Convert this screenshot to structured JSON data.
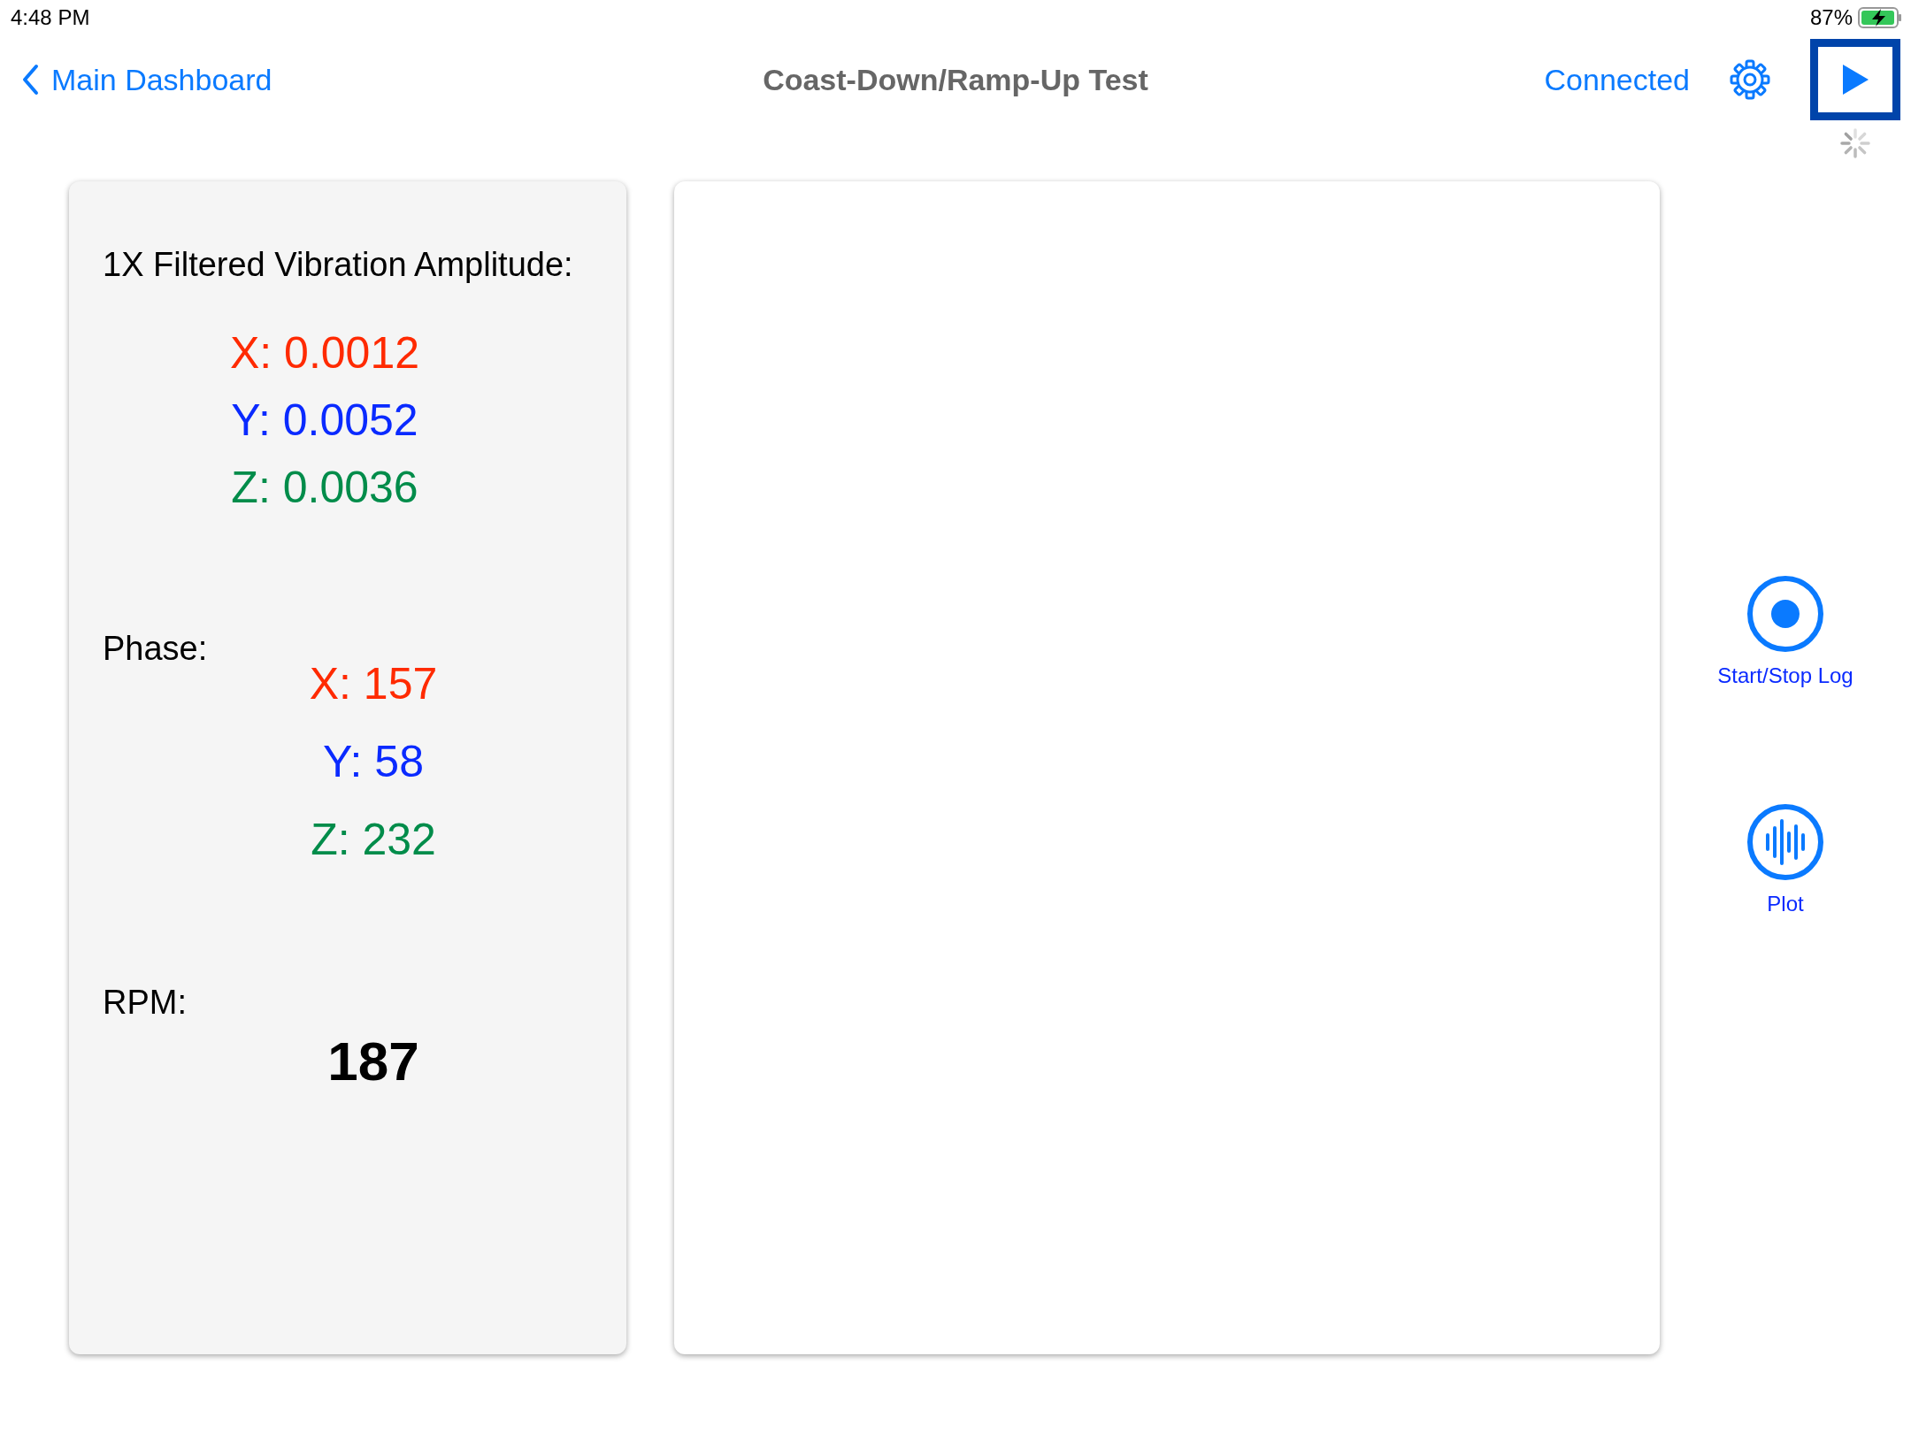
{
  "status_bar": {
    "time": "4:48 PM",
    "battery": "87%"
  },
  "nav_bar": {
    "back": "Main Dashboard",
    "title": "Coast-Down/Ramp-Up Test",
    "connection": "Connected"
  },
  "amplitude": {
    "title": "1X Filtered Vibration Amplitude:",
    "values": [
      {
        "text": "X: 0.0012",
        "color": "#ff2a00"
      },
      {
        "text": "Y: 0.0052",
        "color": "#0a2aff"
      },
      {
        "text": "Z: 0.0036",
        "color": "#008c4a"
      }
    ]
  },
  "phase": {
    "label": "Phase:",
    "values": [
      {
        "text": "X: 157",
        "color": "#ff2a00"
      },
      {
        "text": "Y: 58",
        "color": "#0a2aff"
      },
      {
        "text": "Z: 232",
        "color": "#008c4a"
      }
    ]
  },
  "rpm": {
    "label": "RPM:",
    "value": "187"
  },
  "side_actions": [
    {
      "kind": "record",
      "label": "Start/Stop Log"
    },
    {
      "kind": "plot",
      "label": "Plot"
    }
  ]
}
